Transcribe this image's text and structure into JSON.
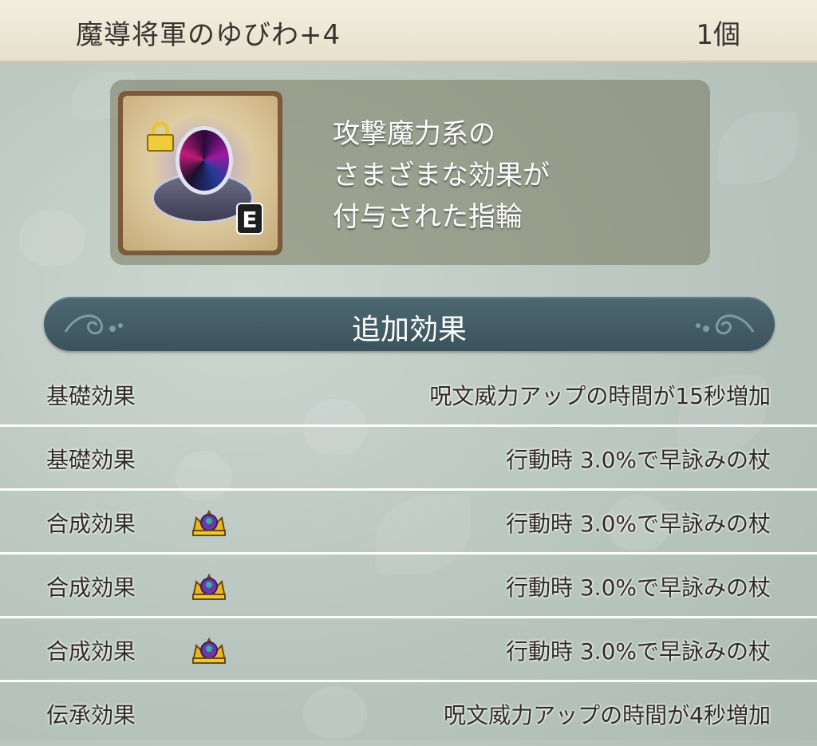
{
  "header": {
    "item_name": "魔導将軍のゆびわ+4",
    "count": "1個"
  },
  "item": {
    "icon": "ring-icon",
    "locked": true,
    "equipped_badge": "E",
    "description": [
      "攻撃魔力系の",
      "さまざまな効果が",
      "付与された指輪"
    ]
  },
  "section": {
    "title": "追加効果"
  },
  "effects": [
    {
      "type": "基礎効果",
      "icon": null,
      "value": "呪文威力アップの時間が15秒増加"
    },
    {
      "type": "基礎効果",
      "icon": null,
      "value": "行動時 3.0%で早詠みの杖"
    },
    {
      "type": "合成効果",
      "icon": "crown-icon",
      "value": "行動時 3.0%で早詠みの杖"
    },
    {
      "type": "合成効果",
      "icon": "crown-icon",
      "value": "行動時 3.0%で早詠みの杖"
    },
    {
      "type": "合成効果",
      "icon": "crown-icon",
      "value": "行動時 3.0%で早詠みの杖"
    },
    {
      "type": "伝承効果",
      "icon": null,
      "value": "呪文威力アップの時間が4秒増加"
    }
  ],
  "colors": {
    "header_bg": "#ece6d3",
    "banner_bg": "#445e68",
    "panel_bg": "#7a7a5f",
    "text_dark": "#2e2a28",
    "crown_gold": "#e8b820",
    "crown_purple": "#6a3aa8"
  }
}
